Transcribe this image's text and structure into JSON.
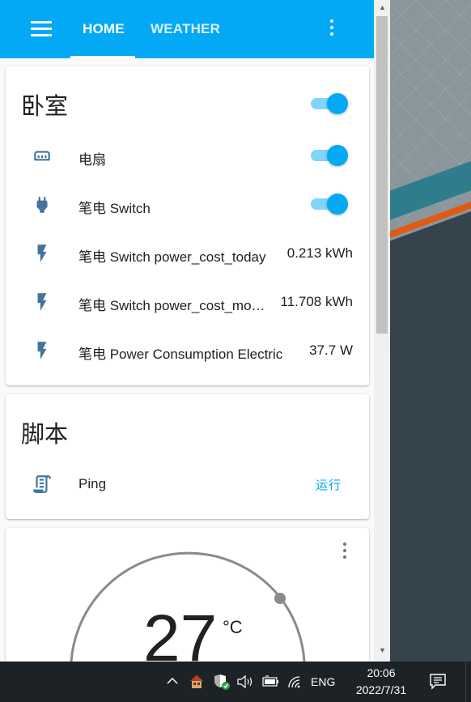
{
  "toolbar": {
    "tabs": [
      {
        "label": "HOME",
        "active": true
      },
      {
        "label": "WEATHER",
        "active": false
      }
    ],
    "menu_icon": "hamburger-menu-icon",
    "more_icon": "vertical-dots-icon",
    "color": "#03a9f4"
  },
  "bedroom_card": {
    "title": "卧室",
    "title_toggle_on": true,
    "rows": [
      {
        "icon": "air-conditioner-icon",
        "label": "电扇",
        "type": "toggle",
        "on": true
      },
      {
        "icon": "power-plug-icon",
        "label": "笔电 Switch",
        "type": "toggle",
        "on": true
      },
      {
        "icon": "flash-icon",
        "label": "笔电 Switch power_cost_today",
        "type": "value",
        "value": "0.213 kWh"
      },
      {
        "icon": "flash-icon",
        "label": "笔电 Switch power_cost_mo…",
        "type": "value",
        "value": "11.708 kWh"
      },
      {
        "icon": "flash-icon",
        "label": "笔电 Power Consumption Electric",
        "type": "value",
        "value": "37.7 W"
      }
    ]
  },
  "script_card": {
    "title": "脚本",
    "rows": [
      {
        "icon": "script-icon",
        "label": "Ping",
        "action": "运行"
      }
    ]
  },
  "thermostat_card": {
    "temperature": "27",
    "unit": "°C",
    "more_icon": "vertical-dots-icon"
  },
  "taskbar": {
    "icons": [
      "chevron-up-icon",
      "home-assistant-icon",
      "security-shield-icon",
      "volume-icon",
      "battery-icon",
      "wifi-icon"
    ],
    "language": "ENG",
    "time": "20:06",
    "date": "2022/7/31",
    "notification_icon": "notification-icon"
  }
}
